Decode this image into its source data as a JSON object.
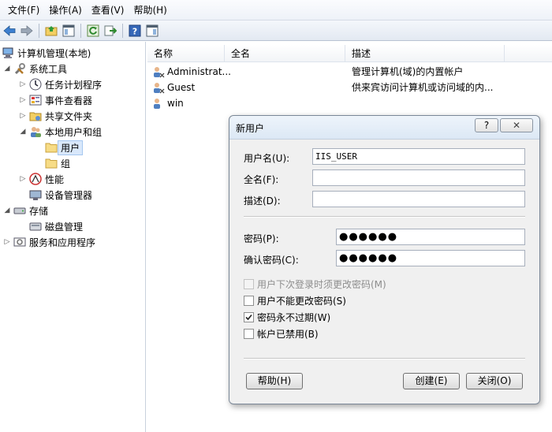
{
  "menu": [
    "文件(F)",
    "操作(A)",
    "查看(V)",
    "帮助(H)"
  ],
  "toolbar": {
    "icons": [
      "back-icon",
      "forward-icon",
      "up-folder-icon",
      "show-tree-icon",
      "refresh-icon",
      "export-icon",
      "help-icon",
      "show-action-pane-icon"
    ]
  },
  "tree": {
    "root": "计算机管理(本地)",
    "system_tools": "系统工具",
    "task_scheduler": "任务计划程序",
    "event_viewer": "事件查看器",
    "shared_folders": "共享文件夹",
    "local_users_groups": "本地用户和组",
    "users": "用户",
    "groups": "组",
    "performance": "性能",
    "device_manager": "设备管理器",
    "storage": "存储",
    "disk_management": "磁盘管理",
    "services_apps": "服务和应用程序"
  },
  "list": {
    "columns": [
      "名称",
      "全名",
      "描述"
    ],
    "rows": [
      {
        "name": "Administrat...",
        "full_name": "",
        "description": "管理计算机(域)的内置帐户"
      },
      {
        "name": "Guest",
        "full_name": "",
        "description": "供来宾访问计算机或访问域的内..."
      },
      {
        "name": "win",
        "full_name": "",
        "description": ""
      }
    ]
  },
  "dialog": {
    "title": "新用户",
    "help_glyph": "?",
    "close_glyph": "✕",
    "username_label": "用户名(U):",
    "username_value": "IIS_USER",
    "fullname_label": "全名(F):",
    "fullname_value": "",
    "description_label": "描述(D):",
    "description_value": "",
    "password_label": "密码(P):",
    "password_value": "●●●●●●",
    "confirm_label": "确认密码(C):",
    "confirm_value": "●●●●●●",
    "checkboxes": [
      {
        "label": "用户下次登录时须更改密码(M)",
        "checked": false,
        "disabled": true
      },
      {
        "label": "用户不能更改密码(S)",
        "checked": false,
        "disabled": false
      },
      {
        "label": "密码永不过期(W)",
        "checked": true,
        "disabled": false
      },
      {
        "label": "帐户已禁用(B)",
        "checked": false,
        "disabled": false
      }
    ],
    "help_button": "帮助(H)",
    "create_button": "创建(E)",
    "close_button": "关闭(O)"
  }
}
